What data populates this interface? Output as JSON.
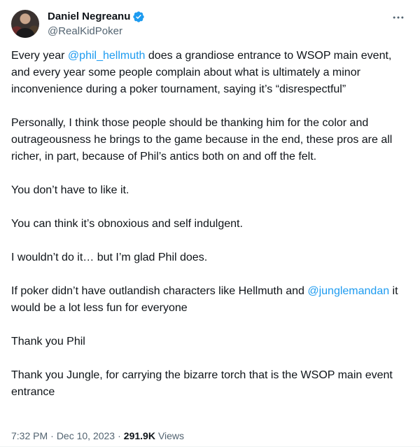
{
  "author": {
    "display_name": "Daniel Negreanu",
    "handle": "@RealKidPoker",
    "verified_icon": "verified-badge-icon",
    "avatar_icon": "avatar-photo"
  },
  "more_icon": "ellipsis-icon",
  "tweet": {
    "p1": {
      "t1": "Every year ",
      "m1": "@phil_hellmuth",
      "t2": " does a grandiose entrance to WSOP main event, and every year some people complain about what is ultimately a minor inconvenience during a poker tournament, saying it’s “disrespectful”"
    },
    "p2": "Personally, I think those people should be thanking him for the color and outrageousness he brings to the game because in the end, these pros are all richer, in part, because of Phil’s antics both on and off the felt.",
    "p3": "You don’t have to like it.",
    "p4": "You can think it’s obnoxious and self indulgent.",
    "p5": "I wouldn’t do it… but I’m glad Phil does.",
    "p6": {
      "t1": "If poker didn’t have outlandish characters like Hellmuth and ",
      "m1": "@junglemandan",
      "t2": " it would be a lot less fun for everyone"
    },
    "p7": "Thank you Phil",
    "p8": "Thank you Jungle, for carrying the bizarre torch that is the WSOP main event entrance"
  },
  "meta": {
    "time": "7:32 PM",
    "separator": "·",
    "date": "Dec 10, 2023",
    "views_count": "291.9K",
    "views_label": "Views"
  },
  "colors": {
    "accent": "#1d9bf0",
    "text": "#0f1419",
    "secondary": "#536471"
  }
}
